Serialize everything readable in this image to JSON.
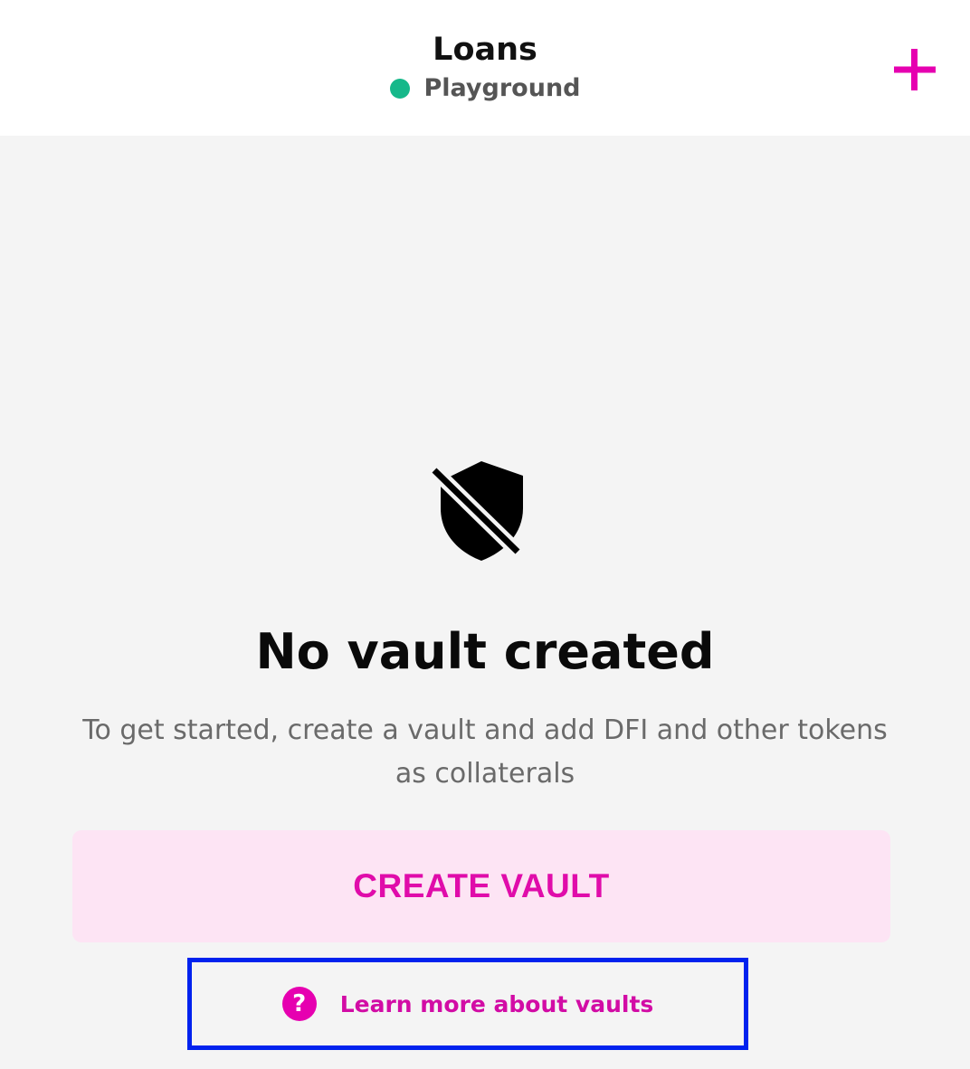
{
  "header": {
    "title": "Loans",
    "network": "Playground",
    "network_color": "#16b88a",
    "add_icon": "plus-icon"
  },
  "empty_state": {
    "icon": "shield-off-icon",
    "title": "No vault created",
    "description": "To get started, create a vault and add DFI and other tokens as collaterals",
    "create_label": "CREATE VAULT",
    "learn_label": "Learn more about vaults",
    "help_icon_glyph": "?"
  },
  "colors": {
    "accent": "#e600b0",
    "button_bg": "#fde4f4",
    "highlight_border": "#0022ee",
    "background": "#f4f4f4"
  }
}
